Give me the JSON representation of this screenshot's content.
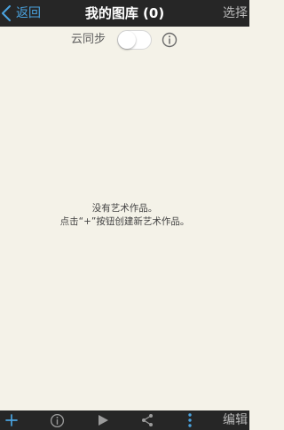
{
  "header": {
    "back_label": "返回",
    "title": "我的图库 (0)",
    "select_label": "选择"
  },
  "sync": {
    "label": "云同步",
    "enabled": false
  },
  "empty_state": {
    "line1": "没有艺术作品。",
    "line2": "点击“+”按钮创建新艺术作品。"
  },
  "toolbar": {
    "edit_label": "编辑"
  },
  "icons": {
    "back": "chevron-left-icon",
    "sync_info": "info-icon",
    "add": "plus-icon",
    "info": "info-icon",
    "play": "play-icon",
    "share": "share-icon",
    "more": "more-vertical-icon"
  },
  "colors": {
    "top_bar": "#262626",
    "bottom_bar": "#262626",
    "background": "#f4f2e8",
    "accent": "#4aa3df",
    "header_title": "#ffffff",
    "secondary_text": "#b9b9b9",
    "toggle_off": "#ffffff"
  }
}
